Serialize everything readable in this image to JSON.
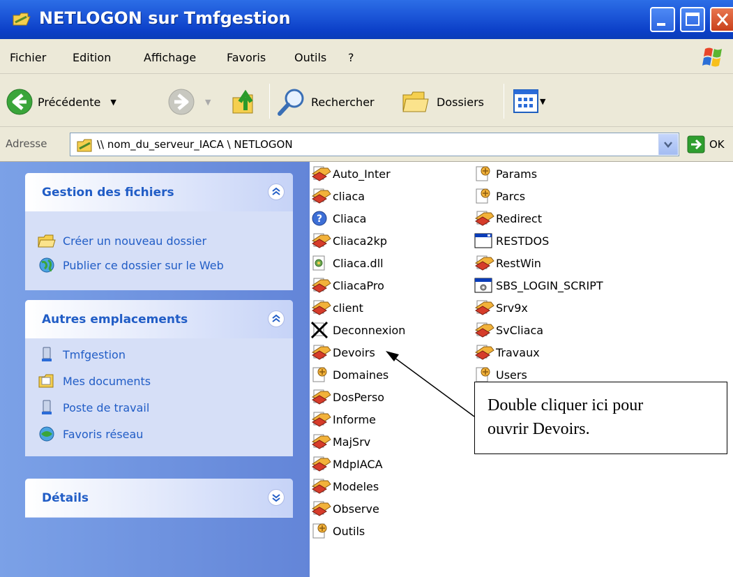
{
  "window": {
    "title": "NETLOGON sur Tmfgestion"
  },
  "menu": [
    "Fichier",
    "Edition",
    "Affichage",
    "Favoris",
    "Outils",
    "?"
  ],
  "toolbar": {
    "back_label": "Précédente",
    "search_label": "Rechercher",
    "folders_label": "Dossiers"
  },
  "address": {
    "label": "Adresse",
    "value": "\\\\ nom_du_serveur_IACA \\ NETLOGON",
    "go_label": "OK"
  },
  "taskpane": {
    "file_tasks": {
      "title": "Gestion des fichiers",
      "links": [
        "Créer un nouveau dossier",
        "Publier ce dossier sur le Web"
      ]
    },
    "other_places": {
      "title": "Autres emplacements",
      "links": [
        "Tmfgestion",
        "Mes documents",
        "Poste de travail",
        "Favoris réseau"
      ]
    },
    "details": {
      "title": "Détails"
    }
  },
  "files": {
    "column1": [
      {
        "name": "Auto_Inter",
        "icon": "batch-file-icon"
      },
      {
        "name": "cliaca",
        "icon": "batch-file-icon"
      },
      {
        "name": "Cliaca",
        "icon": "help-file-icon"
      },
      {
        "name": "Cliaca2kp",
        "icon": "batch-file-icon"
      },
      {
        "name": "Cliaca.dll",
        "icon": "dll-file-icon"
      },
      {
        "name": "CliacaPro",
        "icon": "batch-file-icon"
      },
      {
        "name": "client",
        "icon": "batch-file-icon"
      },
      {
        "name": "Deconnexion",
        "icon": "crossed-file-icon"
      },
      {
        "name": "Devoirs",
        "icon": "batch-file-icon"
      },
      {
        "name": "Domaines",
        "icon": "config-file-icon"
      },
      {
        "name": "DosPerso",
        "icon": "batch-file-icon"
      },
      {
        "name": "Informe",
        "icon": "batch-file-icon"
      },
      {
        "name": "MajSrv",
        "icon": "batch-file-icon"
      },
      {
        "name": "MdpIACA",
        "icon": "batch-file-icon"
      },
      {
        "name": "Modeles",
        "icon": "batch-file-icon"
      },
      {
        "name": "Observe",
        "icon": "batch-file-icon"
      },
      {
        "name": "Outils",
        "icon": "config-file-icon"
      }
    ],
    "column2": [
      {
        "name": "Params",
        "icon": "config-file-icon"
      },
      {
        "name": "Parcs",
        "icon": "config-file-icon"
      },
      {
        "name": "Redirect",
        "icon": "batch-file-icon"
      },
      {
        "name": "RESTDOS",
        "icon": "dos-window-icon"
      },
      {
        "name": "RestWin",
        "icon": "batch-file-icon"
      },
      {
        "name": "SBS_LOGIN_SCRIPT",
        "icon": "script-file-icon"
      },
      {
        "name": "Srv9x",
        "icon": "batch-file-icon"
      },
      {
        "name": "SvCliaca",
        "icon": "batch-file-icon"
      },
      {
        "name": "Travaux",
        "icon": "batch-file-icon"
      },
      {
        "name": "Users",
        "icon": "config-file-icon"
      }
    ]
  },
  "annotation": {
    "line1": "Double cliquer ici pour",
    "line2": "ouvrir Devoirs."
  },
  "colors": {
    "titlebar": "#0b3fc7",
    "taskpane": "#6f95e0",
    "link": "#215dc6"
  }
}
